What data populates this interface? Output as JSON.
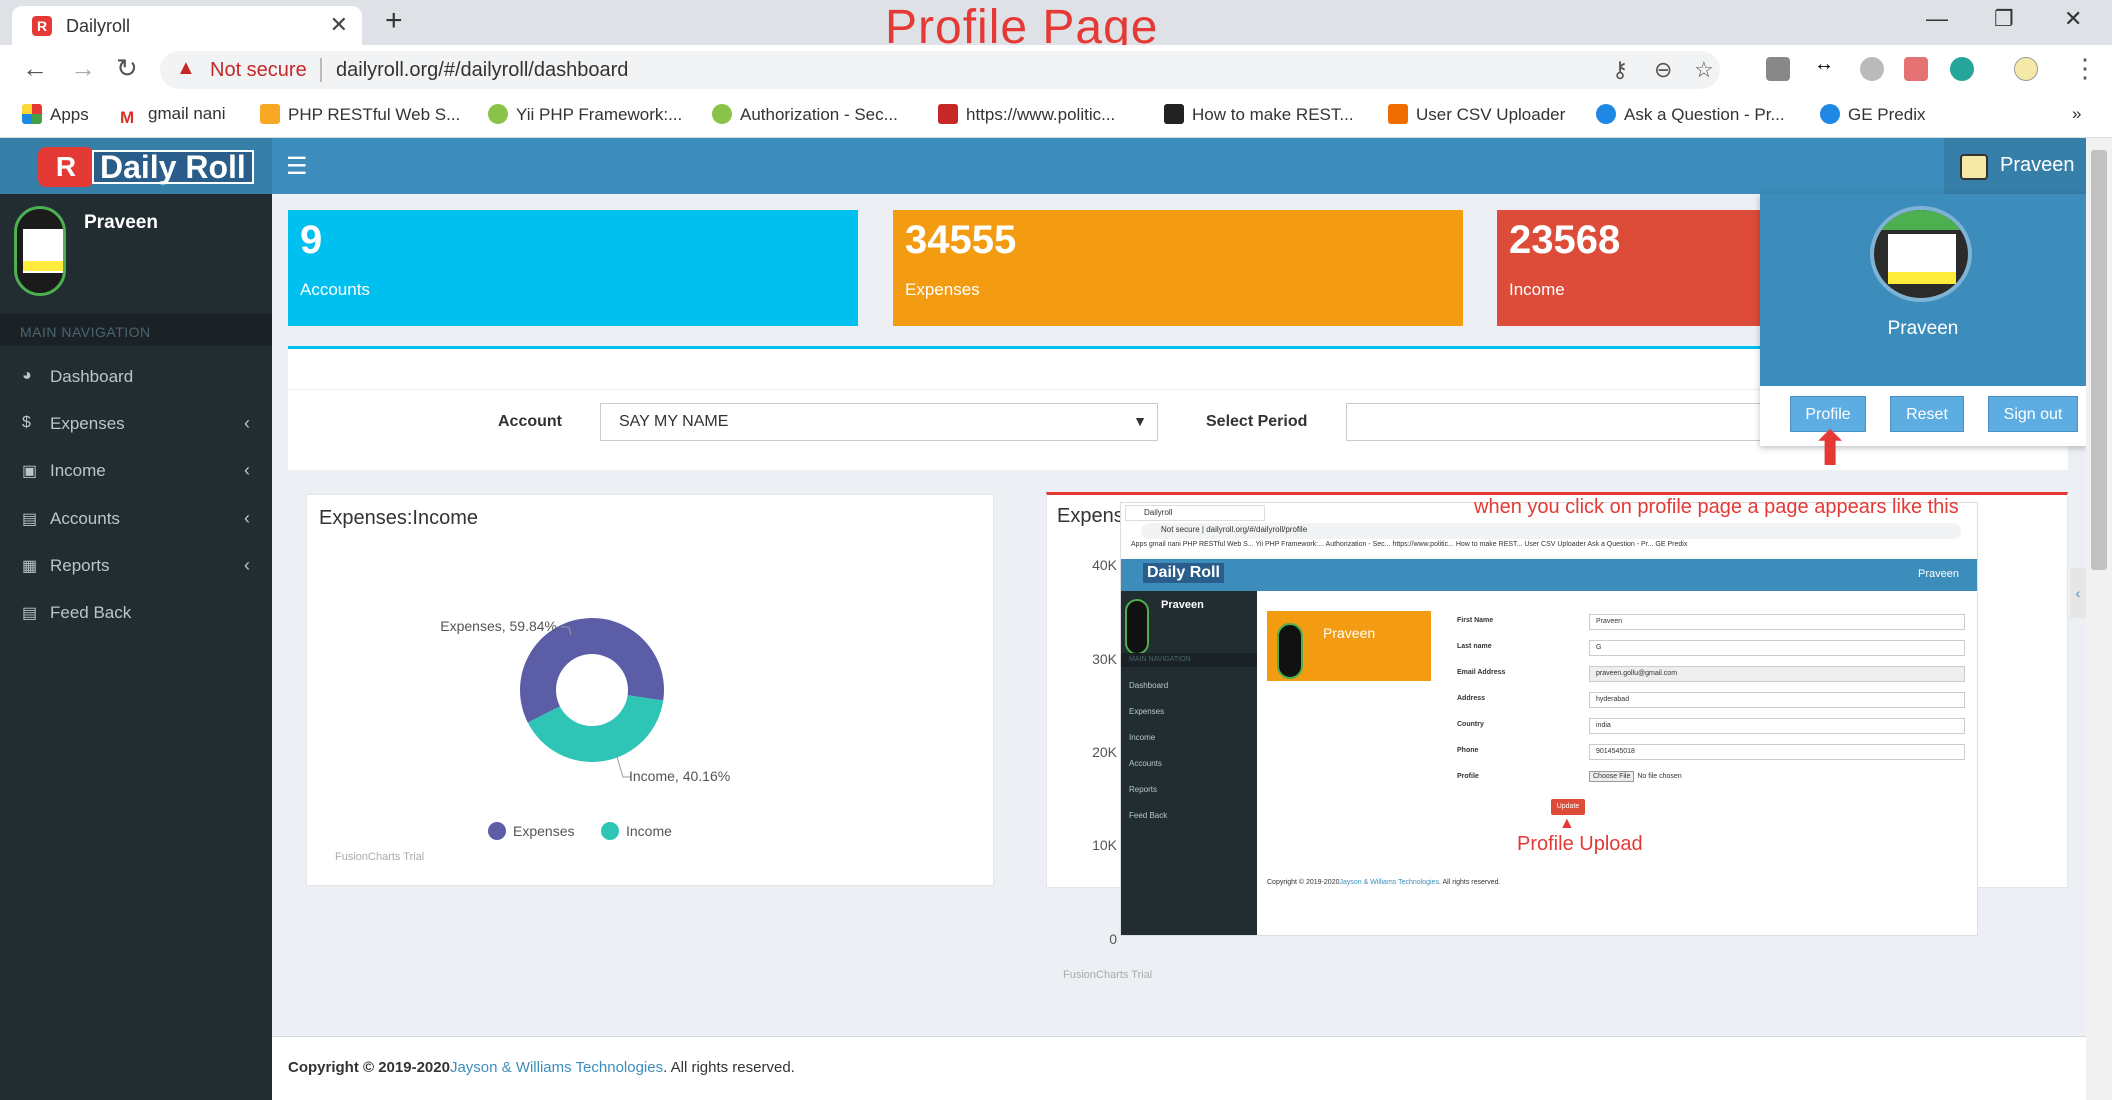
{
  "browser": {
    "tab_title": "Dailyroll",
    "annotation_title": "Profile Page",
    "not_secure": "Not secure",
    "url": "dailyroll.org/#/dailyroll/dashboard",
    "bookmarks": [
      "Apps",
      "gmail nani",
      "PHP RESTful Web S...",
      "Yii PHP Framework:...",
      "Authorization - Sec...",
      "https://www.politic...",
      "How to make REST...",
      "User CSV Uploader",
      "Ask a Question - Pr...",
      "GE Predix"
    ]
  },
  "app": {
    "logo": "Daily Roll",
    "user": "Praveen",
    "nav_header": "MAIN NAVIGATION",
    "sidebar": [
      {
        "label": "Dashboard",
        "icon": "pie-chart-icon",
        "chevron": false
      },
      {
        "label": "Expenses",
        "icon": "dollar-icon",
        "chevron": true
      },
      {
        "label": "Income",
        "icon": "money-icon",
        "chevron": true
      },
      {
        "label": "Accounts",
        "icon": "book-icon",
        "chevron": true
      },
      {
        "label": "Reports",
        "icon": "grid-icon",
        "chevron": true
      },
      {
        "label": "Feed Back",
        "icon": "feedback-icon",
        "chevron": false
      }
    ],
    "stats": [
      {
        "value": "9",
        "label": "Accounts",
        "color": "#00c0ef"
      },
      {
        "value": "34555",
        "label": "Expenses",
        "color": "#f39c12"
      },
      {
        "value": "23568",
        "label": "Income",
        "color": "#dd4b39"
      }
    ],
    "filter": {
      "account_label": "Account",
      "account_value": "SAY MY NAME",
      "period_label": "Select Period"
    },
    "donut": {
      "title": "Expenses:Income",
      "trial": "FusionCharts Trial",
      "legend": [
        "Expenses",
        "Income"
      ]
    },
    "bar": {
      "title": "Expens",
      "yticks": [
        "40K",
        "30K",
        "20K",
        "10K",
        "0"
      ],
      "trial": "FusionCharts Trial"
    },
    "annotation_click": "when you click on profile page a page appears like this",
    "dropdown": {
      "name": "Praveen",
      "buttons": [
        "Profile",
        "Reset",
        "Sign out"
      ]
    },
    "footer": {
      "prefix": "Copyright © 2019-2020",
      "company": "Jayson & Williams Technologies",
      "suffix": ". All rights reserved."
    }
  },
  "nested": {
    "tab": "Dailyroll",
    "url": "Not secure  |  dailyroll.org/#/dailyroll/profile",
    "bookmarks": "Apps   gmail nani   PHP RESTful Web S...   Yii PHP Framework:...   Authorization - Sec...   https://www.politic...   How to make REST...   User CSV Uploader   Ask a Question - Pr...   GE Predix",
    "logo": "Daily Roll",
    "user": "Praveen",
    "nav_header": "MAIN NAVIGATION",
    "sidebar": [
      "Dashboard",
      "Expenses",
      "Income",
      "Accounts",
      "Reports",
      "Feed Back"
    ],
    "card_name": "Praveen",
    "fields": [
      {
        "label": "First Name",
        "value": "Praveen"
      },
      {
        "label": "Last name",
        "value": "G"
      },
      {
        "label": "Email Address",
        "value": "praveen.gollu@gmail.com"
      },
      {
        "label": "Address",
        "value": "hyderabad"
      },
      {
        "label": "Country",
        "value": "india"
      },
      {
        "label": "Phone",
        "value": "9014545018"
      }
    ],
    "profile_label": "Profile",
    "choose_file": "Choose File",
    "no_file": "No file chosen",
    "update": "Update",
    "annotation": "Profile Upload",
    "footer_prefix": "Copyright © 2019-2020",
    "footer_company": "Jayson & Williams Technologies",
    "footer_suffix": ". All rights reserved."
  },
  "chart_data": {
    "type": "pie",
    "title": "Expenses:Income",
    "categories": [
      "Expenses",
      "Income"
    ],
    "values": [
      59.84,
      40.16
    ],
    "data_labels": [
      "Expenses, 59.84%",
      "Income, 40.16%"
    ],
    "colors": [
      "#5b5ea6",
      "#2ec4b6"
    ],
    "legend": "bottom"
  }
}
